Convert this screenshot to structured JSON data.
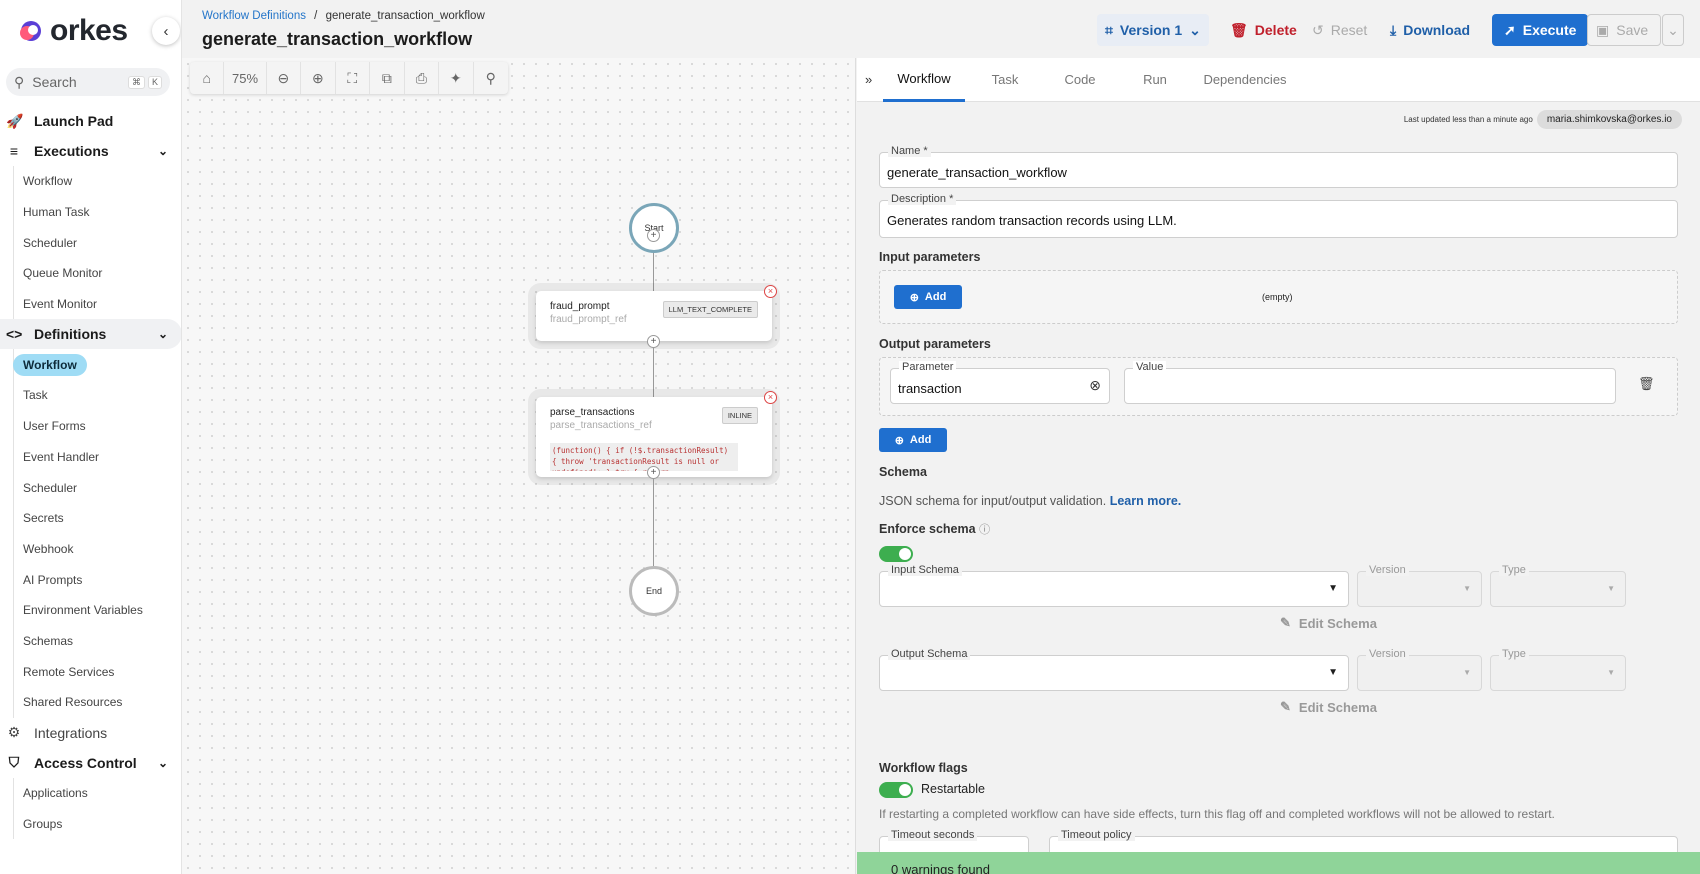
{
  "brand": {
    "name": "orkes"
  },
  "sidebar": {
    "search_placeholder": "Search",
    "search_shortcut": [
      "⌘",
      "K"
    ],
    "launch_pad": "Launch Pad",
    "executions": {
      "label": "Executions",
      "items": [
        "Workflow",
        "Human Task",
        "Scheduler",
        "Queue Monitor",
        "Event Monitor"
      ]
    },
    "definitions": {
      "label": "Definitions",
      "items": [
        "Workflow",
        "Task",
        "User Forms",
        "Event Handler",
        "Scheduler",
        "Secrets",
        "Webhook",
        "AI Prompts",
        "Environment Variables",
        "Schemas",
        "Remote Services",
        "Shared Resources"
      ],
      "selected": "Workflow"
    },
    "integrations": "Integrations",
    "access_control": {
      "label": "Access Control",
      "items": [
        "Applications",
        "Groups"
      ]
    }
  },
  "header": {
    "breadcrumb_link": "Workflow Definitions",
    "breadcrumb_sep": "/",
    "breadcrumb_current": "generate_transaction_workflow",
    "title": "generate_transaction_workflow",
    "version_label": "Version 1",
    "delete_label": "Delete",
    "reset_label": "Reset",
    "download_label": "Download",
    "execute_label": "Execute",
    "save_label": "Save"
  },
  "canvas": {
    "zoom": "75%",
    "start_label": "Start",
    "end_label": "End",
    "tasks": [
      {
        "name": "fraud_prompt",
        "ref": "fraud_prompt_ref",
        "type": "LLM_TEXT_COMPLETE"
      },
      {
        "name": "parse_transactions",
        "ref": "parse_transactions_ref",
        "type": "INLINE",
        "code": "(function() { if (!$.transactionResult) { throw 'transactionResult is null or undefined'; } try { return"
      }
    ]
  },
  "panel": {
    "tabs": [
      "Workflow",
      "Task",
      "Code",
      "Run",
      "Dependencies"
    ],
    "active_tab": "Workflow",
    "last_updated": "Last updated less than a minute ago",
    "user": "maria.shimkovska@orkes.io",
    "name_label": "Name *",
    "name_value": "generate_transaction_workflow",
    "description_label": "Description *",
    "description_value": "Generates random transaction records using LLM.",
    "input_params_title": "Input parameters",
    "add_label": "Add",
    "empty_label": "(empty)",
    "output_params_title": "Output parameters",
    "param_label": "Parameter",
    "param_value": "transaction",
    "value_label": "Value",
    "schema_title": "Schema",
    "schema_text": "JSON schema for input/output validation.",
    "learn_more": "Learn more.",
    "enforce_schema": "Enforce schema",
    "input_schema_label": "Input Schema",
    "output_schema_label": "Output Schema",
    "version_label": "Version",
    "type_label": "Type",
    "edit_schema": "Edit Schema",
    "flags_title": "Workflow flags",
    "restartable": "Restartable",
    "restart_note": "If restarting a completed workflow can have side effects, turn this flag off and completed workflows will not be allowed to restart.",
    "timeout_seconds": "Timeout seconds",
    "timeout_policy": "Timeout policy",
    "warnings": "0 warnings found"
  },
  "colors": {
    "primary": "#1f6fcf",
    "danger": "#c0202c",
    "success": "#3dae4f",
    "selected_nav": "#9fdcf5"
  }
}
